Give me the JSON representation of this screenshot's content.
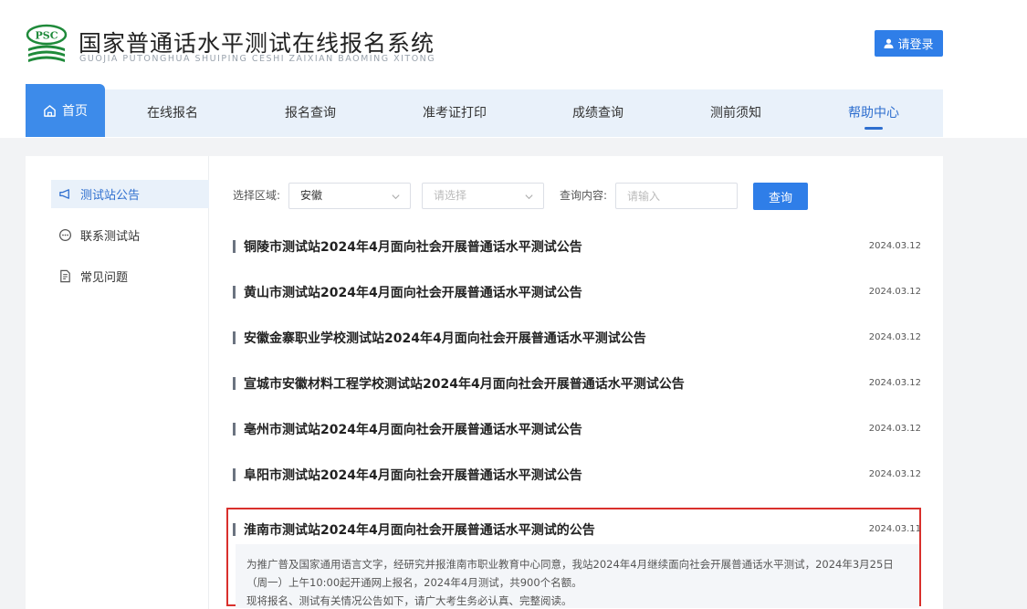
{
  "header": {
    "logo_text": "PSC",
    "title": "国家普通话水平测试在线报名系统",
    "subtitle": "GUOJIA PUTONGHUA SHUIPING CESHI ZAIXIAN BAOMING XITONG",
    "login_label": "请登录"
  },
  "nav": {
    "items": [
      {
        "label": "首页"
      },
      {
        "label": "在线报名"
      },
      {
        "label": "报名查询"
      },
      {
        "label": "准考证打印"
      },
      {
        "label": "成绩查询"
      },
      {
        "label": "测前须知"
      },
      {
        "label": "帮助中心"
      }
    ]
  },
  "sidebar": {
    "items": [
      {
        "label": "测试站公告",
        "icon": "megaphone-icon"
      },
      {
        "label": "联系测试站",
        "icon": "chat-icon"
      },
      {
        "label": "常见问题",
        "icon": "document-icon"
      }
    ]
  },
  "filters": {
    "region_label": "选择区域:",
    "region_value": "安徽",
    "sub_region_placeholder": "请选择",
    "query_label": "查询内容:",
    "query_placeholder": "请输入",
    "query_button": "查询"
  },
  "notices": [
    {
      "title": "铜陵市测试站2024年4月面向社会开展普通话水平测试公告",
      "date": "2024.03.12"
    },
    {
      "title": "黄山市测试站2024年4月面向社会开展普通话水平测试公告",
      "date": "2024.03.12"
    },
    {
      "title": "安徽金寨职业学校测试站2024年4月面向社会开展普通话水平测试公告",
      "date": "2024.03.12"
    },
    {
      "title": "宣城市安徽材料工程学校测试站2024年4月面向社会开展普通话水平测试公告",
      "date": "2024.03.12"
    },
    {
      "title": "亳州市测试站2024年4月面向社会开展普通话水平测试公告",
      "date": "2024.03.12"
    },
    {
      "title": "阜阳市测试站2024年4月面向社会开展普通话水平测试公告",
      "date": "2024.03.12"
    }
  ],
  "highlighted_notice": {
    "title": "淮南市测试站2024年4月面向社会开展普通话水平测试的公告",
    "date": "2024.03.11",
    "summary_line1": "为推广普及国家通用语言文字，经研究并报淮南市职业教育中心同意，我站2024年4月继续面向社会开展普通话水平测试，2024年3月25日",
    "summary_line2": "（周一）上午10:00起开通网上报名，2024年4月测试，共900个名额。",
    "summary_line3": "现将报名、测试有关情况公告如下，请广大考生务必认真、完整阅读。"
  },
  "colors": {
    "primary": "#2f7ee8",
    "nav_bg": "#e9f1fa",
    "highlight_border": "#d9302c",
    "logo_green": "#1f8a3a"
  }
}
